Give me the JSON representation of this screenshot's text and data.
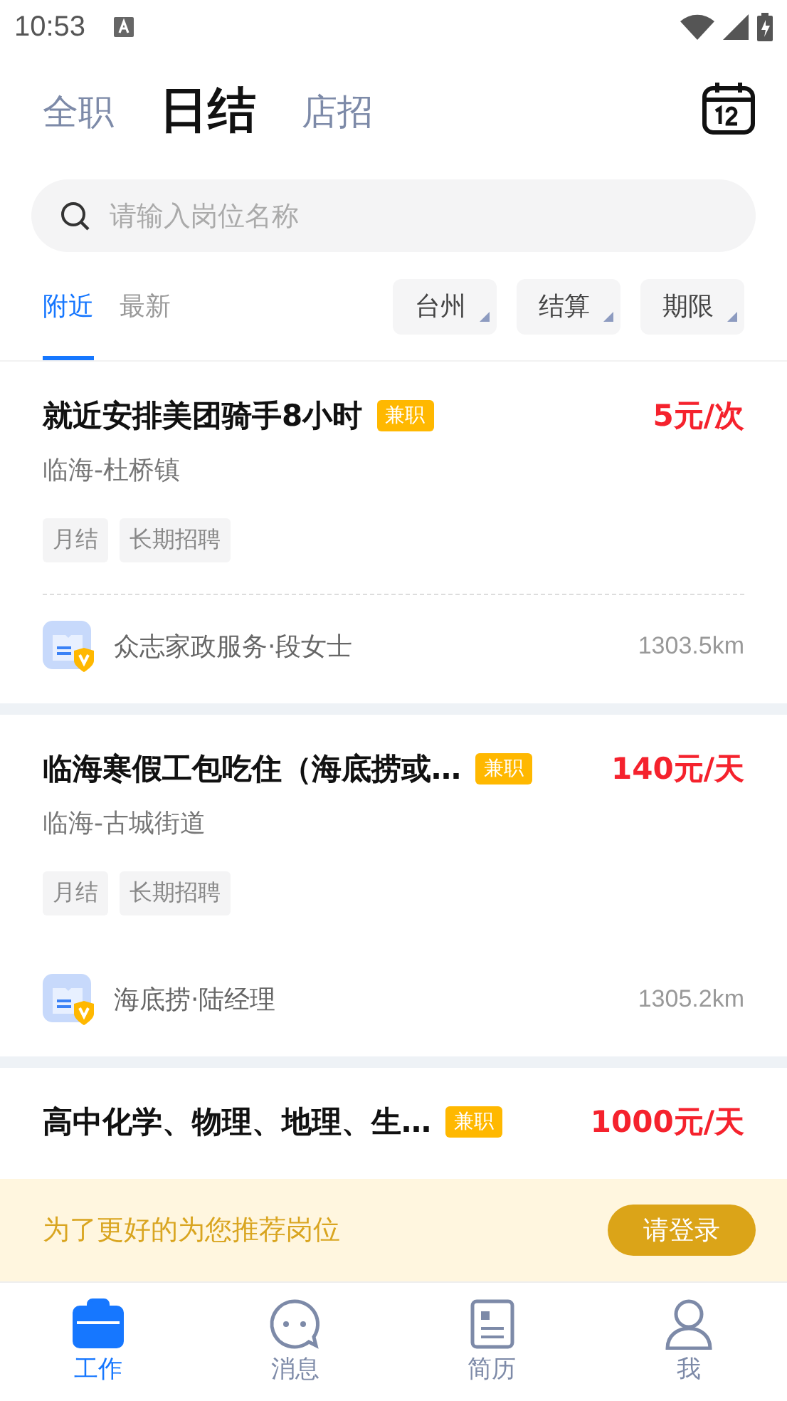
{
  "status_bar": {
    "time": "10:53"
  },
  "header": {
    "tabs": [
      {
        "label": "全职",
        "selected": false
      },
      {
        "label": "日结",
        "selected": true
      },
      {
        "label": "店招",
        "selected": false
      }
    ]
  },
  "search": {
    "placeholder": "请输入岗位名称"
  },
  "list_tabs": [
    {
      "label": "附近",
      "selected": true
    },
    {
      "label": "最新",
      "selected": false
    }
  ],
  "filters": [
    "台州",
    "结算",
    "期限"
  ],
  "jobs": [
    {
      "title": "就近安排美团骑手8小时",
      "badge": "兼职",
      "pay": "5元/次",
      "location": "临海-杜桥镇",
      "tags": [
        "月结",
        "长期招聘"
      ],
      "divider": true,
      "employer": "众志家政服务·段女士",
      "distance": "1303.5km"
    },
    {
      "title": "临海寒假工包吃住（海底捞或…",
      "badge": "兼职",
      "pay": "140元/天",
      "location": "临海-古城街道",
      "tags": [
        "月结",
        "长期招聘"
      ],
      "divider": false,
      "employer": "海底捞·陆经理",
      "distance": "1305.2km"
    },
    {
      "title": "高中化学、物理、地理、生…",
      "badge": "兼职",
      "pay": "1000元/天"
    }
  ],
  "login_banner": {
    "text": "为了更好的为您推荐岗位",
    "button": "请登录"
  },
  "bottom_nav": [
    {
      "label": "工作",
      "kind": "work",
      "selected": true
    },
    {
      "label": "消息",
      "kind": "message",
      "selected": false
    },
    {
      "label": "简历",
      "kind": "resume",
      "selected": false
    },
    {
      "label": "我",
      "kind": "me",
      "selected": false
    }
  ]
}
